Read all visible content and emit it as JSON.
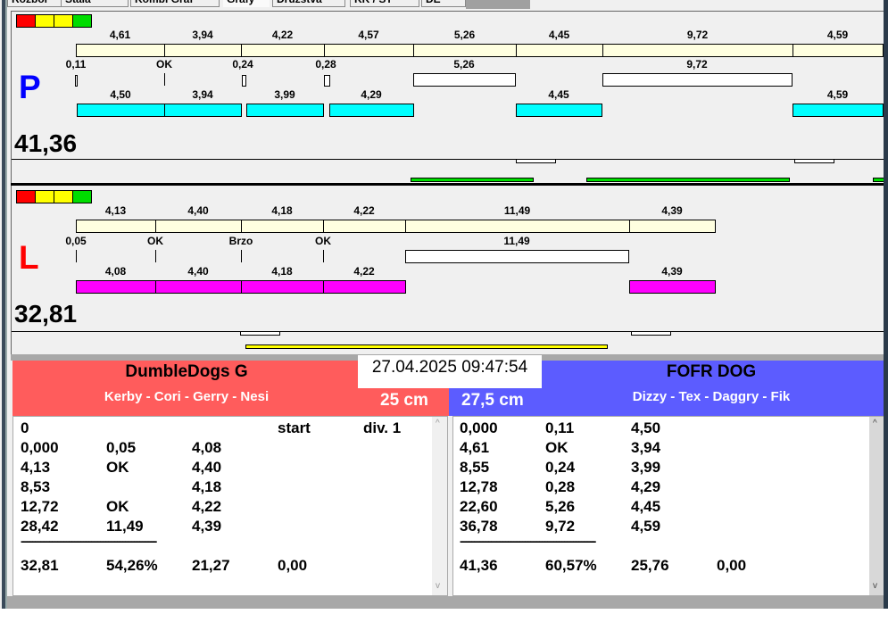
{
  "tabs": [
    "Rozbor",
    "Stala",
    "Kombi Graf",
    "Grafy",
    "Družstva",
    "KK / ST",
    "DE"
  ],
  "colors": {
    "red": "#ff0000",
    "yellow": "#ffff00",
    "green": "#00dd00",
    "cream": "#ffffe0",
    "cyan": "#00ffff",
    "magenta": "#ff00ff",
    "team_left": "#ff5c5c",
    "team_right": "#5c5cff",
    "lane_p": "#0000ff",
    "lane_l": "#ff0000"
  },
  "lane_p": {
    "letter": "P",
    "total": "41,36",
    "splits": [
      "4,61",
      "3,94",
      "4,22",
      "4,57",
      "5,26",
      "4,45",
      "9,72",
      "4,59"
    ],
    "checks": [
      "0,11",
      "OK",
      "0,24",
      "0,28",
      "5,26",
      "9,72"
    ],
    "runs": [
      "4,50",
      "3,94",
      "3,99",
      "4,29",
      "4,45",
      "4,59"
    ]
  },
  "lane_l": {
    "letter": "L",
    "total": "32,81",
    "splits": [
      "4,13",
      "4,40",
      "4,18",
      "4,22",
      "11,49",
      "4,39"
    ],
    "checks": [
      "0,05",
      "OK",
      "Brzo",
      "OK",
      "11,49"
    ],
    "runs": [
      "4,08",
      "4,40",
      "4,18",
      "4,22",
      "4,39"
    ]
  },
  "timestamp": "27.04.2025 09:47:54",
  "left_team": {
    "name": "DumbleDogs G",
    "dogs": "Kerby - Cori - Gerry - Nesi",
    "height": "25 cm",
    "rows": [
      [
        "0",
        "",
        "",
        "start",
        "div. 1"
      ],
      [
        "0,000",
        "0,05",
        "4,08",
        "",
        ""
      ],
      [
        "4,13",
        "OK",
        "4,40",
        "",
        ""
      ],
      [
        "8,53",
        "",
        "4,18",
        "",
        ""
      ],
      [
        "12,72",
        "OK",
        "4,22",
        "",
        ""
      ],
      [
        "28,42",
        "11,49",
        "4,39",
        "",
        ""
      ]
    ],
    "separator": "------------------------------------------------",
    "summary": [
      "32,81",
      "54,26%",
      "21,27",
      "0,00"
    ]
  },
  "right_team": {
    "name": "FOFR DOG",
    "dogs": "Dizzy - Tex - Daggry - Fik",
    "height": "27,5 cm",
    "rows": [
      [
        "0,000",
        "0,11",
        "4,50"
      ],
      [
        "4,61",
        "OK",
        "3,94"
      ],
      [
        "8,55",
        "0,24",
        "3,99"
      ],
      [
        "12,78",
        "0,28",
        "4,29"
      ],
      [
        "22,60",
        "5,26",
        "4,45"
      ],
      [
        "36,78",
        "9,72",
        "4,59"
      ]
    ],
    "separator": "------------------------------------------------",
    "summary": [
      "41,36",
      "60,57%",
      "25,76",
      "0,00"
    ]
  }
}
